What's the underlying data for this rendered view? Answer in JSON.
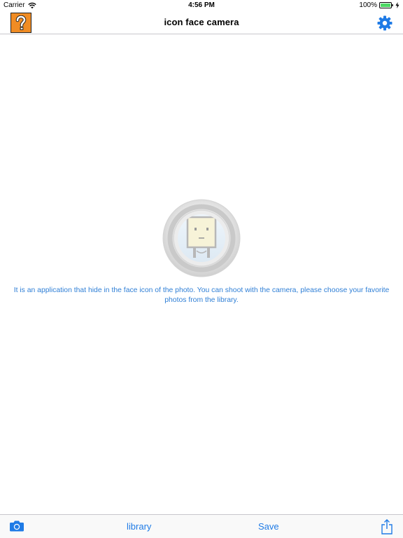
{
  "status_bar": {
    "carrier": "Carrier",
    "time": "4:56 PM",
    "battery": "100%"
  },
  "nav": {
    "title": "icon face camera",
    "help_icon": "question-mark-icon",
    "settings_icon": "gear-icon"
  },
  "main": {
    "description": "It is an application that hide in the face icon of the photo. You can shoot with the camera, please choose your favorite photos from the library."
  },
  "toolbar": {
    "camera_icon": "camera-icon",
    "library_label": "library",
    "save_label": "Save",
    "share_icon": "share-icon"
  },
  "colors": {
    "accent": "#1f7be6",
    "description_text": "#2f7fd6",
    "help_button_bg": "#f08c24",
    "battery": "#4cd964"
  }
}
